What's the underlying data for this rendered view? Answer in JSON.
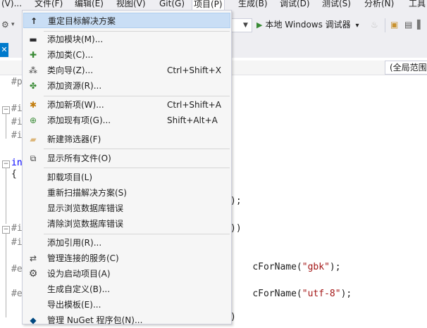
{
  "menubar": {
    "items": [
      "文件(F)",
      "编辑(E)",
      "视图(V)",
      "Git(G)",
      "项目(P)",
      "生成(B)",
      "调试(D)",
      "测试(S)",
      "分析(N)",
      "工具"
    ],
    "partial_left": "(V)..."
  },
  "toolbar": {
    "run_label": "本地 Windows 调试器",
    "run_dropdown": "▾"
  },
  "navbar": {
    "scope": "(全局范围)"
  },
  "editor": {
    "lines": [
      "#p",
      "#i",
      "#i",
      "#i",
      "in",
      "{",
      ");",
      "))",
      "#i",
      "#i",
      "cForName(\"gbk\");",
      "#e",
      "cForName(\"utf-8\");",
      "#e",
      ")"
    ]
  },
  "menu": {
    "items": [
      {
        "label": "重定目标解决方案",
        "shortcut": "",
        "icon": "retarget-icon"
      },
      {
        "label": "添加模块(M)...",
        "shortcut": "",
        "icon": "add-module-icon"
      },
      {
        "label": "添加类(C)...",
        "shortcut": "",
        "icon": "add-class-icon"
      },
      {
        "label": "类向导(Z)...",
        "shortcut": "Ctrl+Shift+X",
        "icon": "class-wizard-icon"
      },
      {
        "label": "添加资源(R)...",
        "shortcut": "",
        "icon": "add-resource-icon"
      },
      {
        "label": "添加新项(W)...",
        "shortcut": "Ctrl+Shift+A",
        "icon": "add-new-item-icon"
      },
      {
        "label": "添加现有项(G)...",
        "shortcut": "Shift+Alt+A",
        "icon": "add-existing-item-icon"
      },
      {
        "label": "新建筛选器(F)",
        "shortcut": "",
        "icon": "new-filter-icon"
      },
      {
        "label": "显示所有文件(O)",
        "shortcut": "",
        "icon": "show-all-files-icon"
      },
      {
        "label": "卸载项目(L)",
        "shortcut": "",
        "icon": ""
      },
      {
        "label": "重新扫描解决方案(S)",
        "shortcut": "",
        "icon": ""
      },
      {
        "label": "显示浏览数据库错误",
        "shortcut": "",
        "icon": ""
      },
      {
        "label": "清除浏览数据库错误",
        "shortcut": "",
        "icon": ""
      },
      {
        "label": "添加引用(R)...",
        "shortcut": "",
        "icon": ""
      },
      {
        "label": "管理连接的服务(C)",
        "shortcut": "",
        "icon": "connected-services-icon"
      },
      {
        "label": "设为启动项目(A)",
        "shortcut": "",
        "icon": "gear-icon"
      },
      {
        "label": "生成自定义(B)...",
        "shortcut": "",
        "icon": ""
      },
      {
        "label": "导出模板(E)...",
        "shortcut": "",
        "icon": ""
      },
      {
        "label": "管理 NuGet 程序包(N)...",
        "shortcut": "",
        "icon": "nuget-icon"
      }
    ]
  },
  "colors": {
    "menu_highlight": "#c9def5",
    "accent": "#007acc",
    "run_green": "#388a34"
  }
}
